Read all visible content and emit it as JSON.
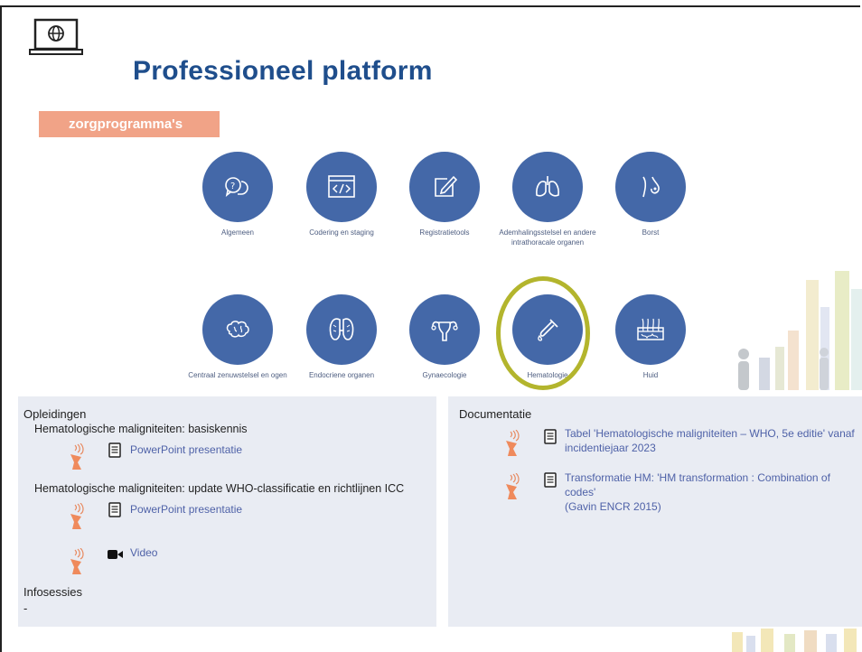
{
  "slide": {
    "title": "Professioneel platform",
    "banner": "zorgprogramma's",
    "icons": {
      "laptop": "laptop-globe-icon"
    }
  },
  "tiles_row1": [
    {
      "label": "Algemeen",
      "icon": "chat-question-icon"
    },
    {
      "label": "Codering en staging",
      "icon": "code-window-icon"
    },
    {
      "label": "Registratietools",
      "icon": "edit-note-icon"
    },
    {
      "label": "Ademhalingsstelsel en andere intrathoracale organen",
      "icon": "lungs-icon"
    },
    {
      "label": "Borst",
      "icon": "breast-icon"
    }
  ],
  "tiles_row2": [
    {
      "label": "Centraal zenuwstelsel en ogen",
      "icon": "brain-icon"
    },
    {
      "label": "Endocriene organen",
      "icon": "thyroid-icon"
    },
    {
      "label": "Gynaecologie",
      "icon": "uterus-icon"
    },
    {
      "label": "Hematologie",
      "icon": "test-tube-icon",
      "highlighted": true
    },
    {
      "label": "Huid",
      "icon": "skin-icon"
    }
  ],
  "opleidingen": {
    "heading": "Opleidingen",
    "course1": {
      "title": "Hematologische maligniteiten: basiskennis",
      "link": "PowerPoint presentatie"
    },
    "course2": {
      "title": "Hematologische maligniteiten: update WHO-classificatie en richtlijnen ICC",
      "link_ppt": "PowerPoint presentatie",
      "link_video": "Video"
    },
    "infosessies_heading": "Infosessies",
    "infosessies_value": "-"
  },
  "documentatie": {
    "heading": "Documentatie",
    "doc1_line1": "Tabel 'Hematologische maligniteiten – WHO, 5e editie' vanaf",
    "doc1_line2": "incidentiejaar 2023",
    "doc2_line1": "Transformatie HM: 'HM transformation : Combination of codes'",
    "doc2_line2": "(Gavin ENCR 2015)"
  },
  "colors": {
    "circle": "#4468a8",
    "title": "#1f4e8c",
    "banner": "#f1a387",
    "highlight": "#b3b52d",
    "panel": "#e9ecf3",
    "link": "#4f62a8"
  }
}
